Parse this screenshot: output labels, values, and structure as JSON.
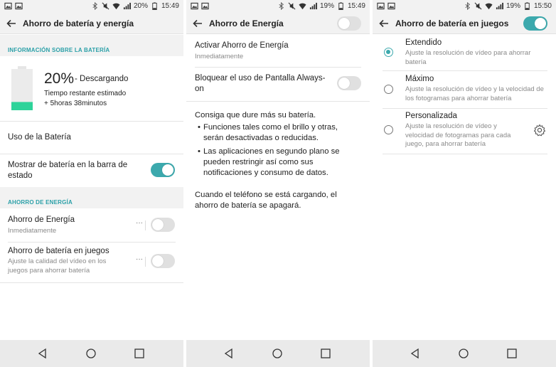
{
  "screens": [
    {
      "status": {
        "battery": "20%",
        "time": "15:49"
      },
      "title": "Ahorro de batería y energía",
      "section_info": "INFORMACIÓN SOBRE LA BATERÍA",
      "battery_percent": "20%",
      "battery_state": "- Descargando",
      "battery_level": 0.2,
      "remaining_label": "Tiempo restante estimado",
      "remaining_value": "+ 5horas 38minutos",
      "usage_label": "Uso de la Batería",
      "show_bar_label": "Mostrar de batería en la barra de estado",
      "show_bar_on": true,
      "section_saving": "AHORRO DE ENERGÍA",
      "saver_title": "Ahorro de Energía",
      "saver_sub": "Inmediatamente",
      "game_title": "Ahorro de batería en juegos",
      "game_sub": "Ajuste la calidad del vídeo en los juegos para ahorrar batería",
      "more_dots": "···"
    },
    {
      "status": {
        "battery": "19%",
        "time": "15:49"
      },
      "title": "Ahorro de Energía",
      "activate_title": "Activar Ahorro de Energía",
      "activate_sub": "Inmediatamente",
      "aod_title": "Bloquear el uso de Pantalla Always-on",
      "intro": "Consiga que dure más su batería.",
      "bullets": [
        "Funciones tales como el brillo y otras, serán desactivadas o reducidas.",
        "Las aplicaciones en segundo plano se pueden restringir así como sus notificaciones y consumo de datos."
      ],
      "charging_note": "Cuando el teléfono se está cargando, el ahorro de batería se apagará."
    },
    {
      "status": {
        "battery": "19%",
        "time": "15:50"
      },
      "title": "Ahorro de batería en juegos",
      "options": [
        {
          "title": "Extendido",
          "desc": "Ajuste la resolución de vídeo para ahorrar batería",
          "selected": true
        },
        {
          "title": "Máximo",
          "desc": "Ajuste la resolución de vídeo y la velocidad de los fotogramas para ahorrar batería",
          "selected": false
        },
        {
          "title": "Personalizada",
          "desc": "Ajuste la resolución de vídeo y velocidad de fotogramas para cada juego, para ahorrar batería",
          "selected": false
        }
      ]
    }
  ],
  "icons": [
    "image-icon",
    "bluetooth-icon",
    "mute-icon",
    "wifi-icon",
    "signal-icon",
    "battery-icon",
    "back-arrow-icon",
    "gear-icon",
    "nav-back-icon",
    "nav-home-icon",
    "nav-recents-icon"
  ],
  "colors": {
    "accent": "#3ca9ad",
    "battery_fill": "#2ed39a",
    "header_bg": "#f2f2f2"
  }
}
